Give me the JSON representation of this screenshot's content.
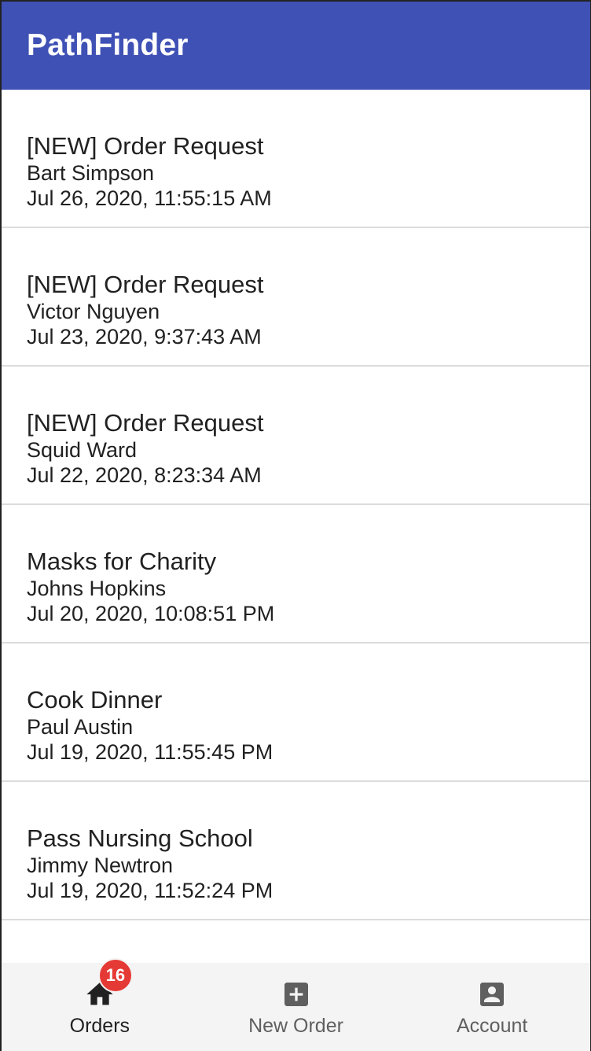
{
  "app": {
    "title": "PathFinder"
  },
  "orders": [
    {
      "title": "[NEW] Order Request",
      "name": "Bart Simpson",
      "date": "Jul 26, 2020, 11:55:15 AM"
    },
    {
      "title": "[NEW] Order Request",
      "name": "Victor Nguyen",
      "date": "Jul 23, 2020, 9:37:43 AM"
    },
    {
      "title": "[NEW] Order Request",
      "name": "Squid Ward",
      "date": "Jul 22, 2020, 8:23:34 AM"
    },
    {
      "title": "Masks for Charity",
      "name": "Johns Hopkins",
      "date": "Jul 20, 2020, 10:08:51 PM"
    },
    {
      "title": "Cook Dinner",
      "name": "Paul Austin",
      "date": "Jul 19, 2020, 11:55:45 PM"
    },
    {
      "title": "Pass Nursing School",
      "name": "Jimmy Newtron",
      "date": "Jul 19, 2020, 11:52:24 PM"
    }
  ],
  "bottom_nav": {
    "orders": {
      "label": "Orders",
      "badge": "16",
      "icon": "home-icon"
    },
    "new_order": {
      "label": "New Order",
      "icon": "add-box-icon"
    },
    "account": {
      "label": "Account",
      "icon": "account-box-icon"
    }
  },
  "colors": {
    "app_bar": "#3f51b5",
    "badge": "#e53935",
    "nav_background": "#f4f4f4"
  }
}
